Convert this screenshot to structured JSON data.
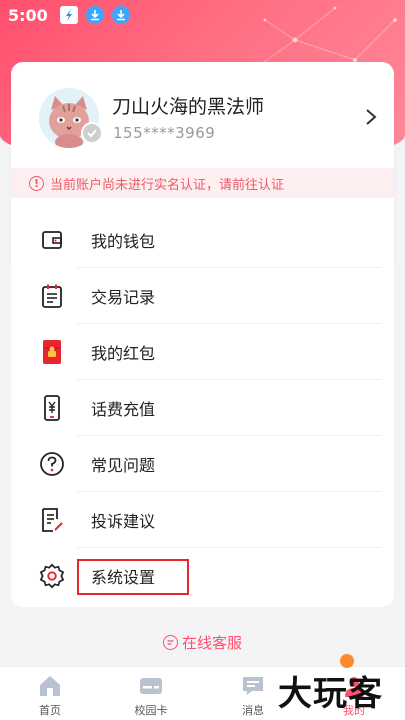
{
  "status_bar": {
    "time": "5:00"
  },
  "profile": {
    "username": "刀山火海的黑法师",
    "phone": "155****3969",
    "notice": "当前账户尚未进行实名认证，请前往认证"
  },
  "menu": {
    "items": [
      {
        "label": "我的钱包",
        "icon": "wallet-icon"
      },
      {
        "label": "交易记录",
        "icon": "transaction-record-icon"
      },
      {
        "label": "我的红包",
        "icon": "red-envelope-icon"
      },
      {
        "label": "话费充值",
        "icon": "phone-recharge-icon"
      },
      {
        "label": "常见问题",
        "icon": "question-icon"
      },
      {
        "label": "投诉建议",
        "icon": "feedback-icon"
      },
      {
        "label": "系统设置",
        "icon": "gear-icon"
      }
    ]
  },
  "service": {
    "label": "在线客服"
  },
  "tabbar": {
    "tabs": [
      {
        "label": "首页",
        "icon": "home-icon"
      },
      {
        "label": "校园卡",
        "icon": "card-icon"
      },
      {
        "label": "消息",
        "icon": "message-icon"
      },
      {
        "label": "我的",
        "icon": "profile-icon"
      }
    ]
  },
  "watermark": {
    "text": "大玩客"
  },
  "colors": {
    "brand": "#ff4f6e",
    "notice_bg": "#fdeff0",
    "notice_text": "#ee5a66",
    "highlight": "#e8242f"
  }
}
